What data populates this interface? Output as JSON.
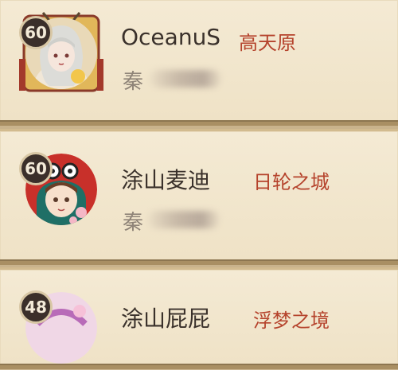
{
  "players": [
    {
      "level": "60",
      "name": "OceanuS",
      "server": "高天原",
      "realm_prefix": "秦",
      "avatar_icon": "white-haired-character-portrait-icon"
    },
    {
      "level": "60",
      "name": "涂山麦迪",
      "server": "日轮之城",
      "realm_prefix": "秦",
      "avatar_icon": "daruma-hood-character-portrait-icon"
    },
    {
      "level": "48",
      "name": "涂山屁屁",
      "server": "浮梦之境",
      "realm_prefix": "",
      "avatar_icon": "pink-character-portrait-icon"
    }
  ],
  "colors": {
    "card_bg": "#f4ead4",
    "name_text": "#3a312b",
    "server_text": "#b5432c",
    "level_badge": "#3b2f2a"
  }
}
